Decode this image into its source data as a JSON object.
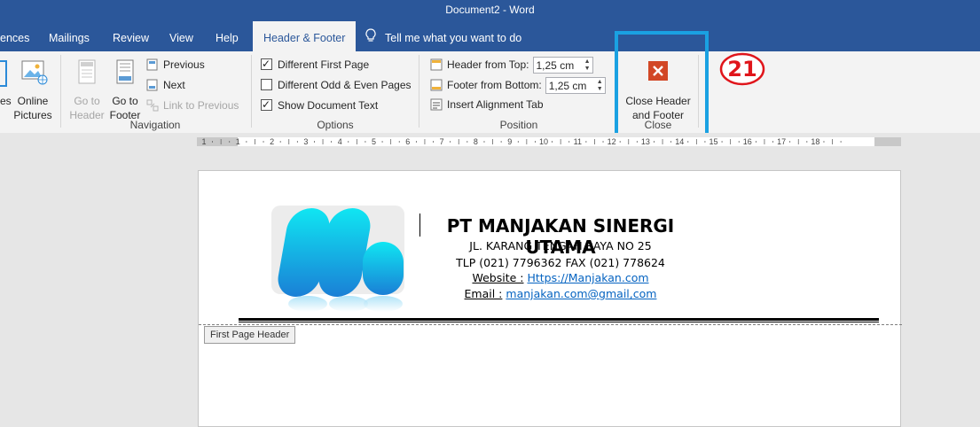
{
  "window": {
    "title": "Document2  -  Word"
  },
  "tabs": [
    {
      "label": "ences"
    },
    {
      "label": "Mailings"
    },
    {
      "label": "Review"
    },
    {
      "label": "View"
    },
    {
      "label": "Help"
    },
    {
      "label": "Header & Footer",
      "active": true
    }
  ],
  "tell_me": {
    "label": "Tell me what you want to do"
  },
  "ribbon": {
    "insert": {
      "partial_label": "es",
      "online_pictures_line1": "Online",
      "online_pictures_line2": "Pictures"
    },
    "navigation": {
      "goto_header_line1": "Go to",
      "goto_header_line2": "Header",
      "goto_footer_line1": "Go to",
      "goto_footer_line2": "Footer",
      "previous": "Previous",
      "next": "Next",
      "link_to_previous": "Link to Previous",
      "group_label": "Navigation"
    },
    "options": {
      "different_first_page": {
        "label": "Different First Page",
        "checked": true
      },
      "different_odd_even": {
        "label": "Different Odd & Even Pages",
        "checked": false
      },
      "show_document_text": {
        "label": "Show Document Text",
        "checked": true
      },
      "group_label": "Options"
    },
    "position": {
      "header_from_top": {
        "label": "Header from Top:",
        "value": "1,25 cm"
      },
      "footer_from_bottom": {
        "label": "Footer from Bottom:",
        "value": "1,25 cm"
      },
      "insert_alignment_tab": "Insert Alignment Tab",
      "group_label": "Position"
    },
    "close": {
      "button_line1": "Close Header",
      "button_line2": "and Footer",
      "group_label": "Close"
    }
  },
  "annotation": {
    "step_number": "21"
  },
  "ruler": {
    "ticks": [
      "1",
      "1",
      "2",
      "3",
      "4",
      "5",
      "6",
      "7",
      "8",
      "9",
      "10",
      "11",
      "12",
      "13",
      "14",
      "15",
      "16",
      "17",
      "18"
    ]
  },
  "document": {
    "header": {
      "company_name": "PT MANJAKAN SINERGI UTAMA",
      "address": "JL. KARANG TENGAH RAYA NO 25",
      "phone": "TLP (021) 7796362 FAX (021) 778624",
      "website_label": "Website :",
      "website_value": "Https://Manjakan.com",
      "email_label": "Email :",
      "email_value": "manjakan.com@gmail,com"
    },
    "first_page_header_tag": "First Page Header"
  },
  "colors": {
    "accent": "#2b579a",
    "highlight_box": "#1aa1e2",
    "callout": "#e0151b",
    "link": "#0563c1",
    "close_icon": "#d24726"
  }
}
